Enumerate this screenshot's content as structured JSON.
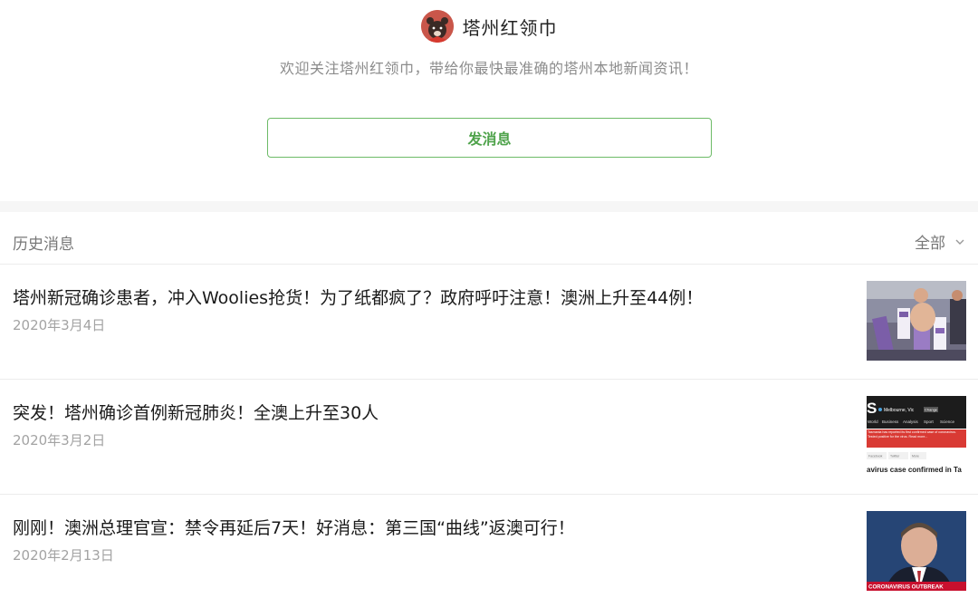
{
  "profile": {
    "name": "塔州红领巾",
    "description": "欢迎关注塔州红领巾，带给你最快最准确的塔州本地新闻资讯！",
    "send_button": "发消息",
    "avatar_icon": "bear-avatar-icon"
  },
  "history": {
    "title": "历史消息",
    "filter_label": "全部",
    "filter_icon": "chevron-down-icon"
  },
  "articles": [
    {
      "title": "塔州新冠确诊患者，冲入Woolies抢货！为了纸都疯了？政府呼吁注意！澳洲上升至44例！",
      "date": "2020年3月4日"
    },
    {
      "title": "突发！塔州确诊首例新冠肺炎！全澳上升至30人",
      "date": "2020年3月2日",
      "thumb_text": {
        "location": "Melbourne, Vic",
        "change": "Change",
        "nav": [
          "World",
          "Business",
          "Analysis",
          "Sport",
          "Science"
        ],
        "alert": "Tasmania has reported its first confirmed case of coronavirus. Tested positive for the virus. Read more...",
        "headline": "avirus case confirmed in Ta",
        "share": [
          "Facebook",
          "Twitter",
          "More"
        ]
      }
    },
    {
      "title": "刚刚！澳洲总理官宣：禁令再延后7天！好消息：第三国“曲线”返澳可行！",
      "date": "2020年2月13日",
      "thumb_text": {
        "banner": "CORONAVIRUS OUTBREAK"
      }
    }
  ],
  "colors": {
    "accent_green": "#4fa34b",
    "border_green": "#6dbb67",
    "muted_text": "#a3a3a3"
  }
}
